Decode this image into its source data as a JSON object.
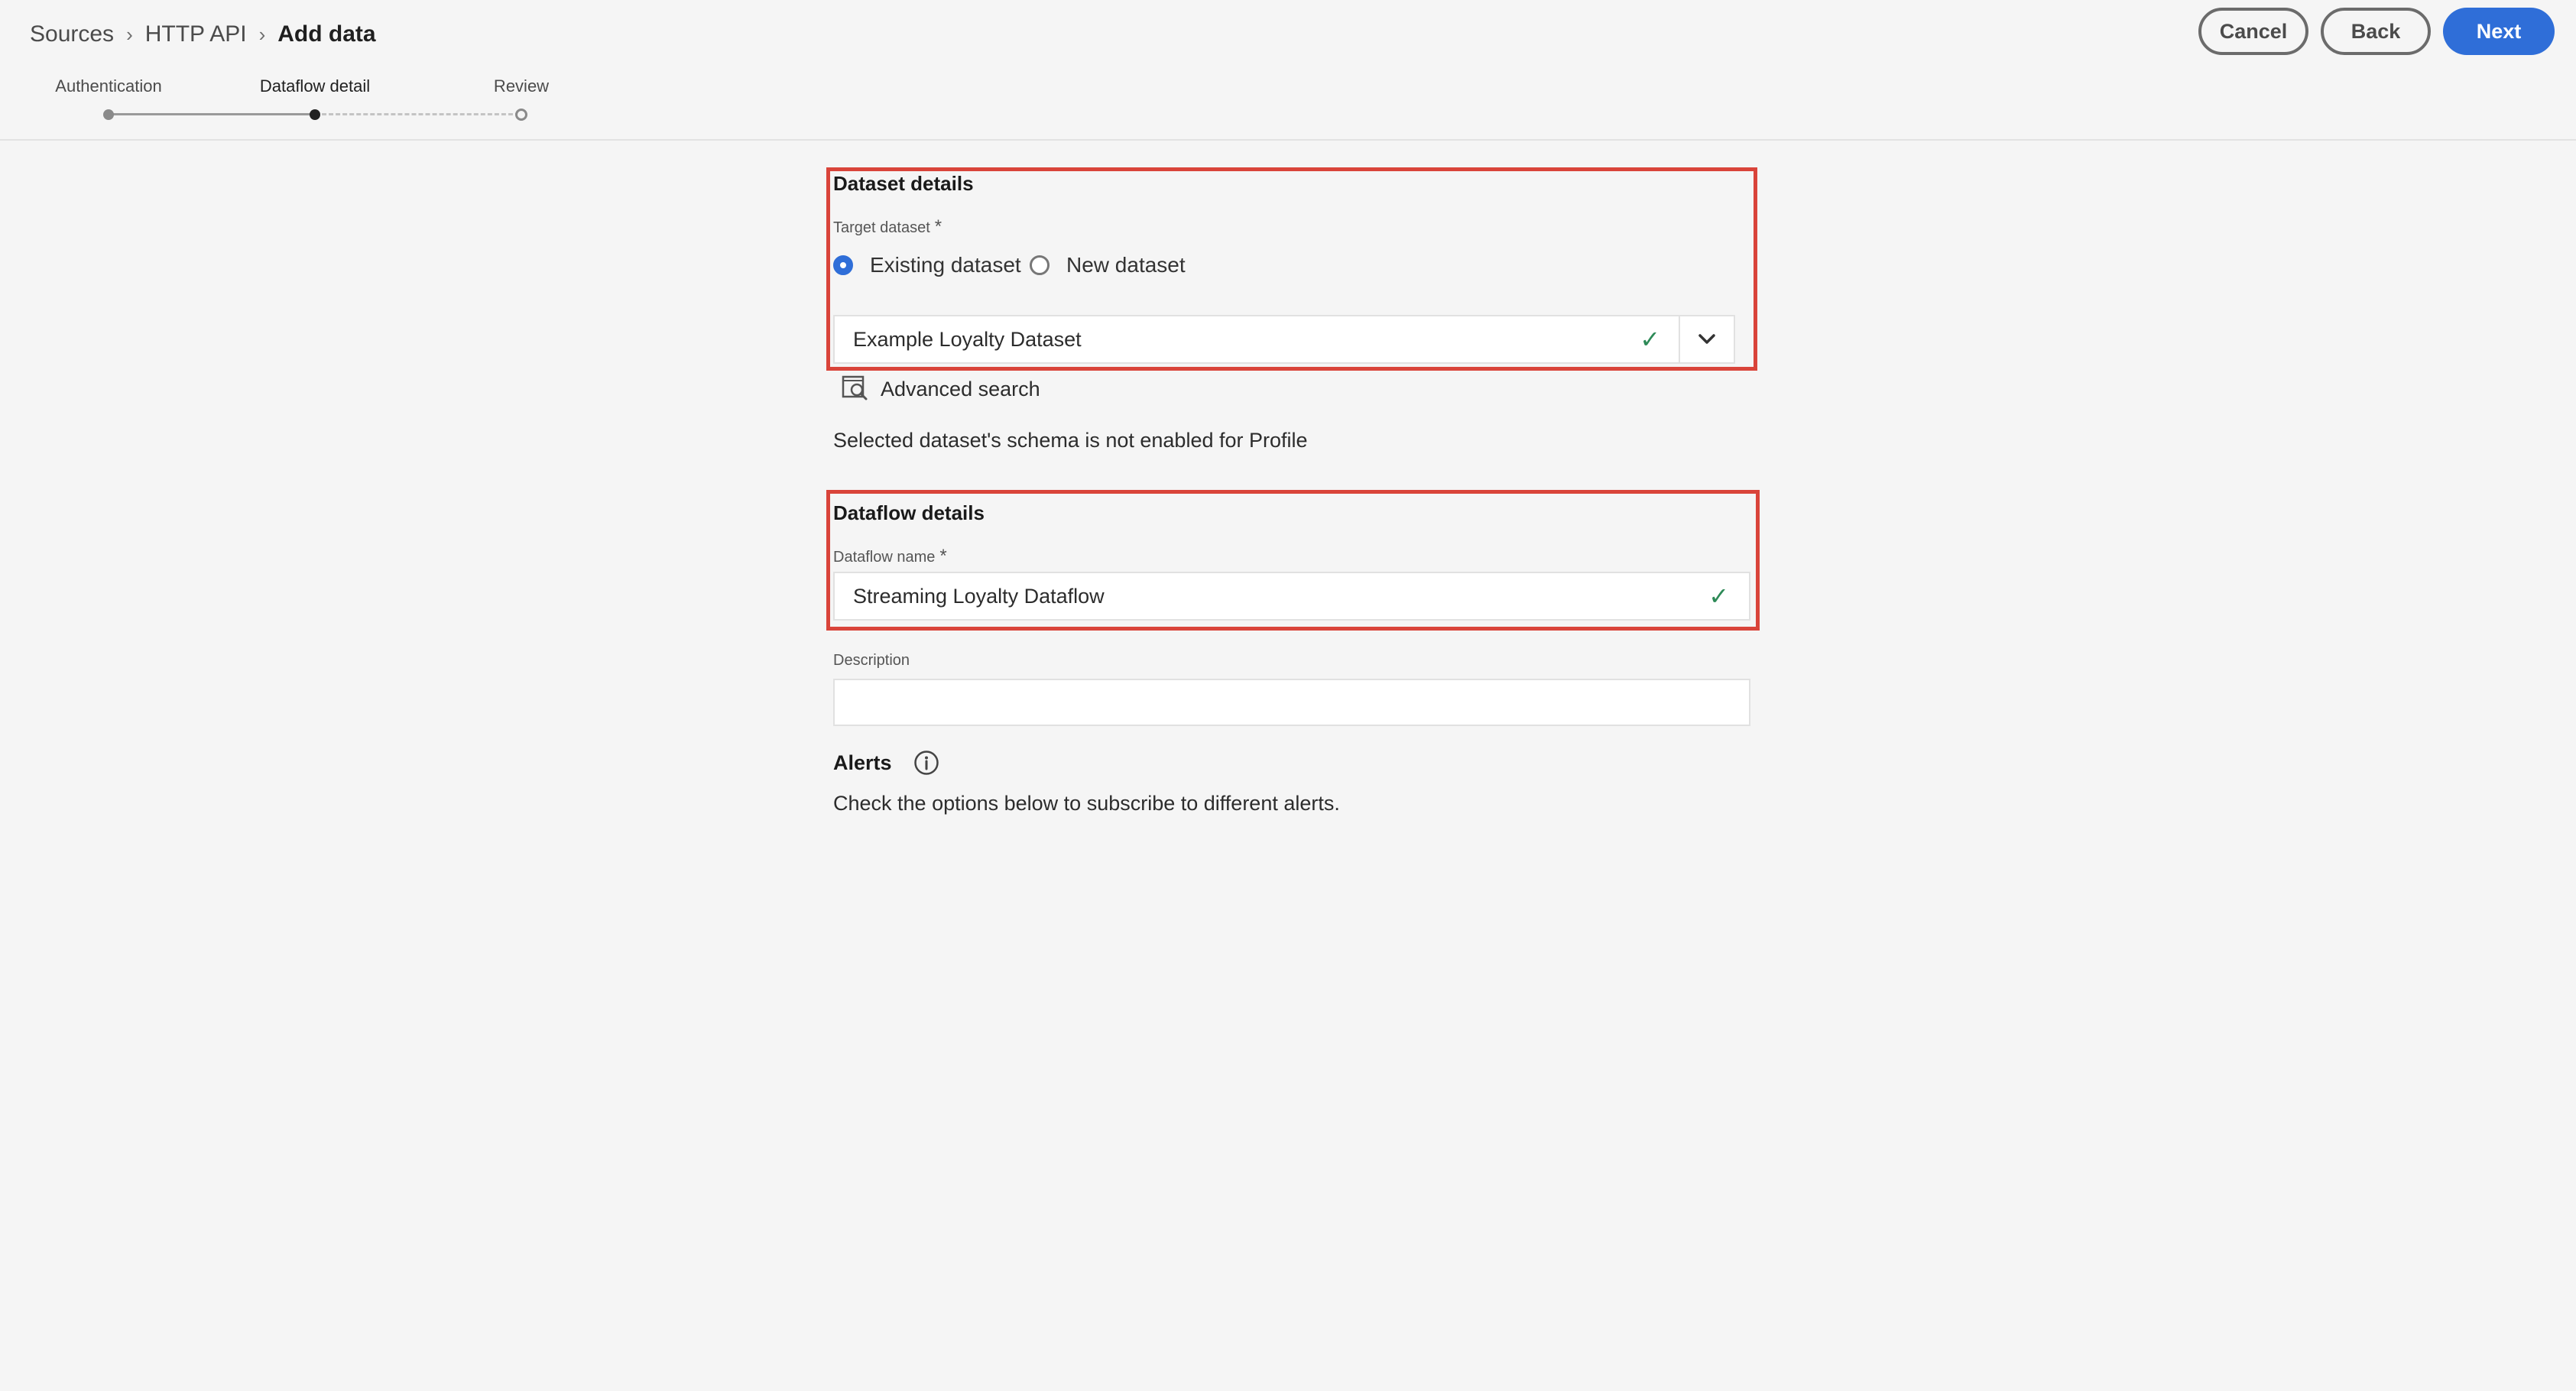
{
  "breadcrumb": {
    "items": [
      "Sources",
      "HTTP API"
    ],
    "current": "Add data"
  },
  "actions": {
    "cancel": "Cancel",
    "back": "Back",
    "next": "Next"
  },
  "stepper": {
    "steps": [
      "Authentication",
      "Dataflow detail",
      "Review"
    ],
    "active_index": 1
  },
  "dataset_details": {
    "title": "Dataset details",
    "target_label": "Target dataset",
    "required_mark": "*",
    "options": [
      "Existing dataset",
      "New dataset"
    ],
    "selected_option": "Existing dataset",
    "selected_dataset": "Example Loyalty Dataset",
    "advanced_search": "Advanced search",
    "profile_note": "Selected dataset's schema is not enabled for Profile"
  },
  "dataflow_details": {
    "title": "Dataflow details",
    "name_label": "Dataflow name",
    "required_mark": "*",
    "name_value": "Streaming Loyalty Dataflow",
    "description_label": "Description",
    "description_value": ""
  },
  "alerts": {
    "title": "Alerts",
    "description": "Check the options below to subscribe to different alerts."
  },
  "colors": {
    "accent": "#2f6ed8",
    "highlight": "#d9443a",
    "valid": "#2d8a57",
    "background": "#f5f5f5"
  }
}
